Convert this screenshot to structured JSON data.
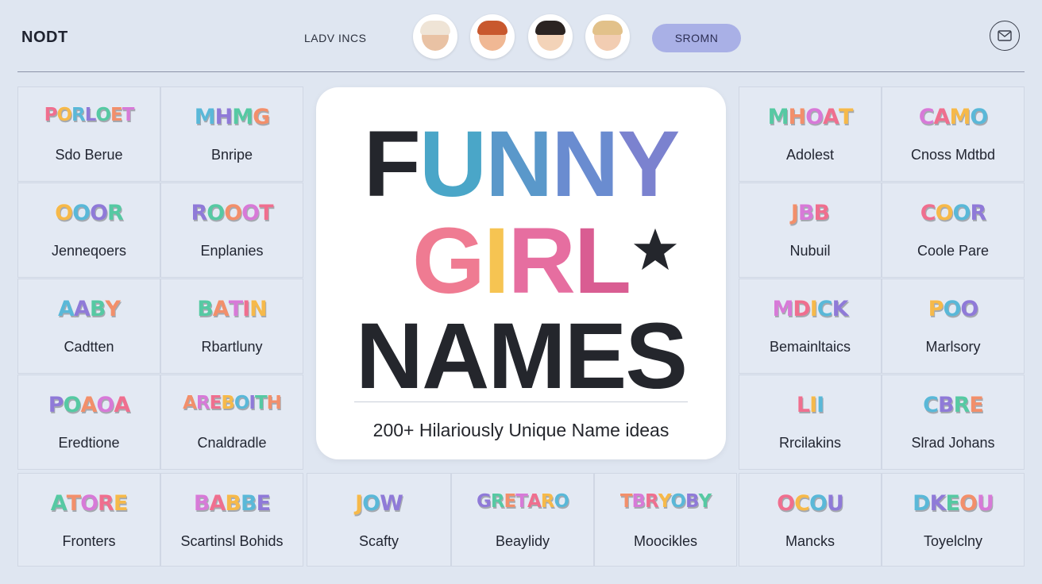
{
  "header": {
    "brand": "NODT",
    "nav_link": "LADV INCS",
    "pill_button": "SROMN",
    "mail_icon": "mail-icon"
  },
  "avatars": [
    {
      "name": "avatar-1",
      "skin": "#e9c2a4",
      "hair": "#efe4d6"
    },
    {
      "name": "avatar-2",
      "skin": "#f0b894",
      "hair": "#c8582e"
    },
    {
      "name": "avatar-3",
      "skin": "#f3d3b8",
      "hair": "#2b2422"
    },
    {
      "name": "avatar-4",
      "skin": "#f2cdb2",
      "hair": "#e2c18a"
    }
  ],
  "hero": {
    "line1": [
      "F",
      "U",
      "N",
      "N",
      "Y"
    ],
    "line2": [
      "G",
      "I",
      "R",
      "L"
    ],
    "line3": "NAMES",
    "tagline": "200+ Hilariously Unique Name ideas",
    "star_icon": "star-icon"
  },
  "palette": [
    "#ef6f8f",
    "#f6b94a",
    "#5ab8d8",
    "#8f7ad8",
    "#56c9a3",
    "#f28f6b",
    "#d77ad8"
  ],
  "name_cards": [
    {
      "logo": "PORLOET",
      "label": "Sdo Berue"
    },
    {
      "logo": "MHMG",
      "label": "Bnripe"
    },
    {
      "logo": "MHOAT",
      "label": "Adolest"
    },
    {
      "logo": "CAMO",
      "label": "Cnoss Mdtbd"
    },
    {
      "logo": "OOOR",
      "label": "Jenneqoers"
    },
    {
      "logo": "ROOOT",
      "label": "Enplanies"
    },
    {
      "logo": "JBB",
      "label": "Nubuil"
    },
    {
      "logo": "COOR",
      "label": "Coole Pare"
    },
    {
      "logo": "AABY",
      "label": "Cadtten"
    },
    {
      "logo": "BATIN",
      "label": "Rbartluny"
    },
    {
      "logo": "MDICK",
      "label": "Bemainltaics"
    },
    {
      "logo": "POO",
      "label": "Marlsory"
    },
    {
      "logo": "POAOA",
      "label": "Eredtione"
    },
    {
      "logo": "AREBOITH",
      "label": "Cnaldradle"
    },
    {
      "logo": "LII",
      "label": "Rrcilakins"
    },
    {
      "logo": "CBRE",
      "label": "Slrad Johans"
    },
    {
      "logo": "ATORE",
      "label": "Fronters"
    },
    {
      "logo": "BABBE",
      "label": "Scartinsl Bohids"
    },
    {
      "logo": "JOW",
      "label": "Scafty"
    },
    {
      "logo": "GRETARO",
      "label": "Beaylidy"
    },
    {
      "logo": "TBRYOBY",
      "label": "Moocikles"
    },
    {
      "logo": "OCOU",
      "label": "Mancks"
    },
    {
      "logo": "DKEOU",
      "label": "Toyelclny"
    }
  ]
}
